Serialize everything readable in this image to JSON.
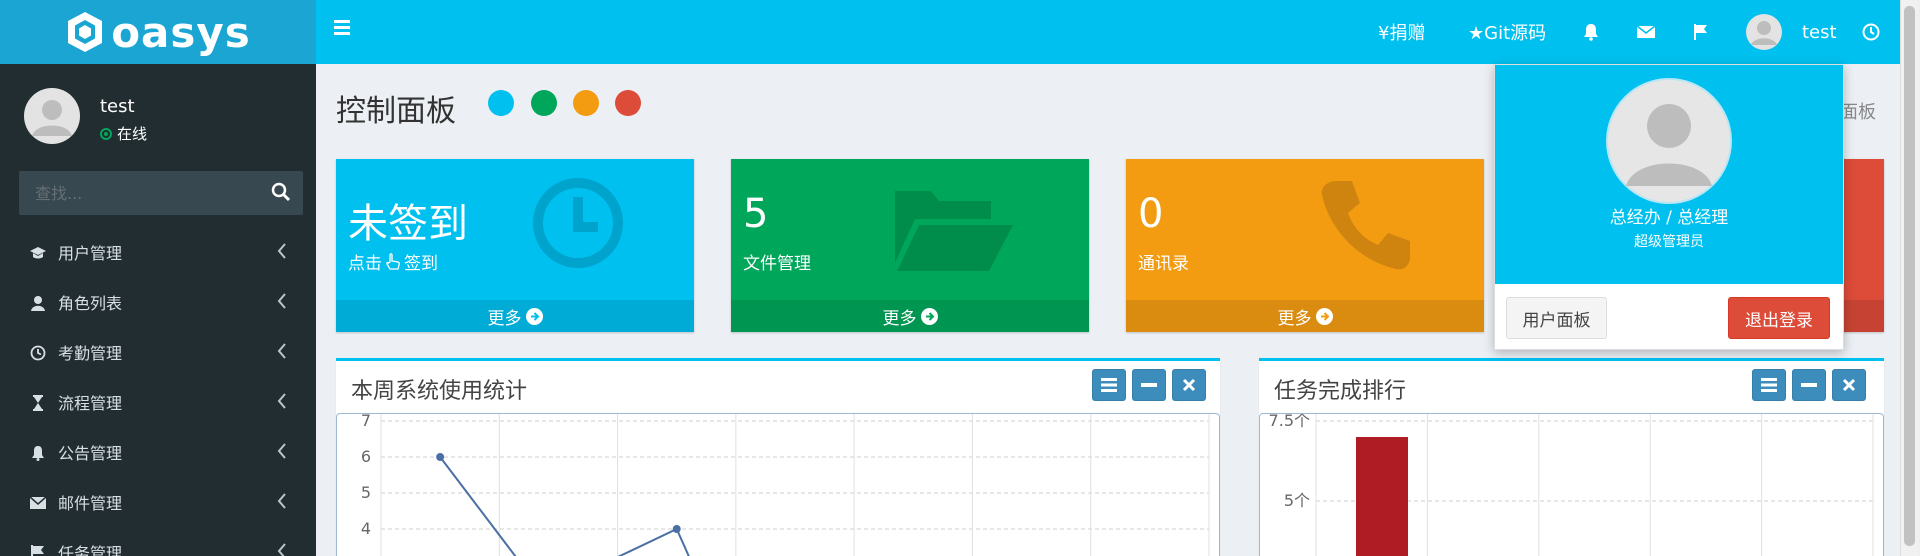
{
  "brand": {
    "logo_text": "oasys"
  },
  "topbar": {
    "donate_label": "¥捐赠",
    "git_label": "★Git源码",
    "user_name": "test"
  },
  "sidebar": {
    "user": {
      "name": "test",
      "status": "在线"
    },
    "search": {
      "placeholder": "查找..."
    },
    "items": [
      {
        "label": "用户管理",
        "icon": "graduation-cap-icon"
      },
      {
        "label": "角色列表",
        "icon": "user-icon"
      },
      {
        "label": "考勤管理",
        "icon": "clock-icon"
      },
      {
        "label": "流程管理",
        "icon": "hourglass-icon"
      },
      {
        "label": "公告管理",
        "icon": "bell-icon"
      },
      {
        "label": "邮件管理",
        "icon": "envelope-icon"
      },
      {
        "label": "任务管理",
        "icon": "flag-icon"
      }
    ]
  },
  "page": {
    "title": "控制面板",
    "breadcrumb_fragment": "面板",
    "skin_colors": [
      "#00c0ef",
      "#00a65a",
      "#f39c12",
      "#dd4b39"
    ]
  },
  "cards": [
    {
      "value": "未签到",
      "label_prefix": "点击",
      "label_suffix": "签到",
      "footer": "更多",
      "color": "#00c0ef",
      "icon": "clock-icon"
    },
    {
      "value": "5",
      "label": "文件管理",
      "footer": "更多",
      "color": "#00a65a",
      "icon": "folder-open-icon"
    },
    {
      "value": "0",
      "label": "通讯录",
      "footer": "更多",
      "color": "#f39c12",
      "icon": "phone-icon"
    },
    {
      "color": "#dd4b39"
    }
  ],
  "panels": {
    "usage": {
      "title": "本周系统使用统计"
    },
    "ranking": {
      "title": "任务完成排行"
    }
  },
  "dropdown": {
    "role": "总经办 / 总经理",
    "position": "超级管理员",
    "profile_button": "用户面板",
    "logout_button": "退出登录"
  },
  "chart_data": [
    {
      "type": "line",
      "title": "本周系统使用统计",
      "y_ticks": [
        "4",
        "5",
        "6",
        "7"
      ],
      "points": [
        {
          "x": 0,
          "y": 6
        },
        {
          "x": 2,
          "y": 4
        }
      ],
      "grid": true
    },
    {
      "type": "bar",
      "title": "任务完成排行",
      "y_ticks": [
        "5个",
        "7.5个"
      ],
      "values": [
        7
      ],
      "grid": true,
      "color": "#b01c24"
    }
  ]
}
